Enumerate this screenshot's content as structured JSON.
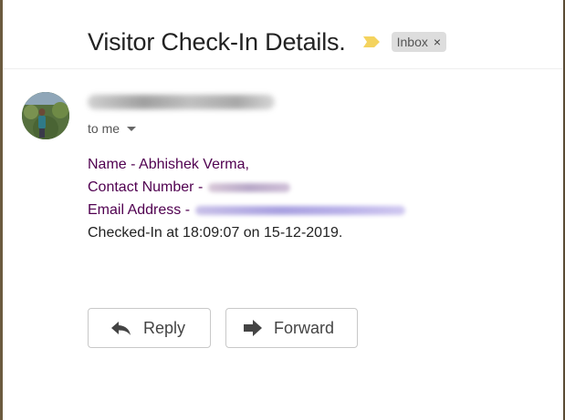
{
  "email": {
    "subject": "Visitor Check-In Details.",
    "label": "Inbox",
    "label_close_glyph": "×",
    "recipient_text": "to me",
    "body": {
      "name_line": "Name - Abhishek Verma,",
      "contact_label": "Contact Number -",
      "email_label": "Email Address -",
      "checkin_line": "Checked-In at 18:09:07 on 15-12-2019."
    }
  },
  "actions": {
    "reply_label": "Reply",
    "forward_label": "Forward"
  },
  "icons": {
    "importance": "importance-marker-icon",
    "reply": "reply-arrow-icon",
    "forward": "forward-arrow-icon",
    "dropdown": "caret-down-icon"
  },
  "colors": {
    "importance_marker": "#f4d35e",
    "label_chip_bg": "#dddddd",
    "body_link_purple": "#500050"
  }
}
